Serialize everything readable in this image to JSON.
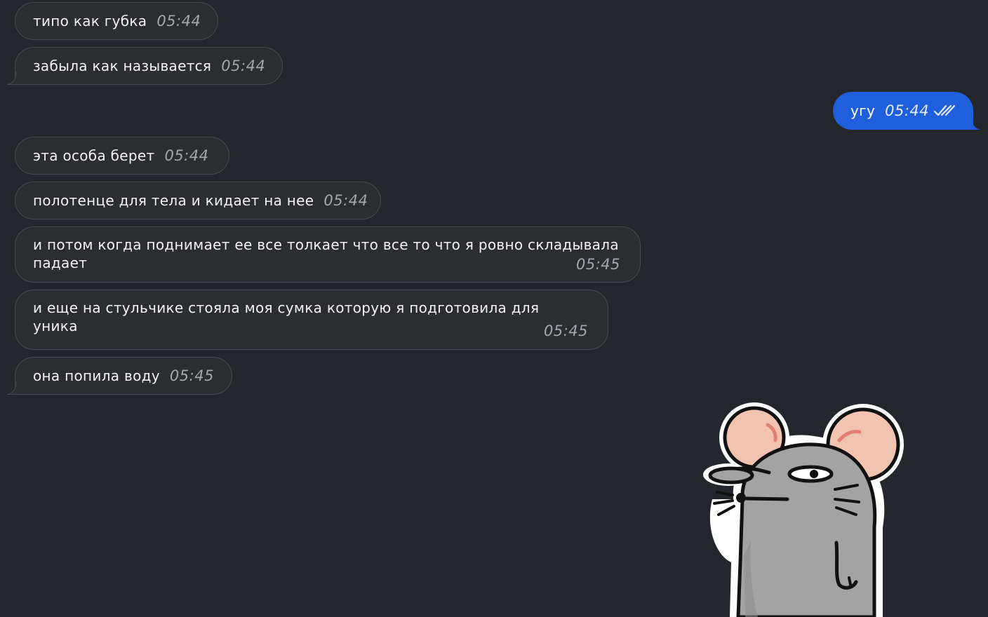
{
  "messages": [
    {
      "text": "типо как губка",
      "time": "05:44",
      "direction": "incoming"
    },
    {
      "text": "забыла как называется",
      "time": "05:44",
      "direction": "incoming"
    },
    {
      "text": "угу",
      "time": "05:44",
      "direction": "outgoing",
      "status": "read"
    },
    {
      "text": "эта особа берет",
      "time": "05:44",
      "direction": "incoming"
    },
    {
      "text": "полотенце для тела и кидает на нее",
      "time": "05:44",
      "direction": "incoming"
    },
    {
      "text": "и потом когда поднимает ее все толкает что все то что я ровно складывала падает",
      "time": "05:45",
      "direction": "incoming"
    },
    {
      "text": "и еще на стульчике стояла моя сумка которую я подготовила для уника",
      "time": "05:45",
      "direction": "incoming"
    },
    {
      "text": "она попила воду",
      "time": "05:45",
      "direction": "incoming"
    }
  ],
  "sticker": {
    "icon": "mouse-sticker-icon"
  },
  "colors": {
    "background": "#23262a",
    "incoming_bubble": "#2b2d30",
    "outgoing_bubble": "#1f5fdb",
    "timestamp": "#a3a7ad"
  }
}
